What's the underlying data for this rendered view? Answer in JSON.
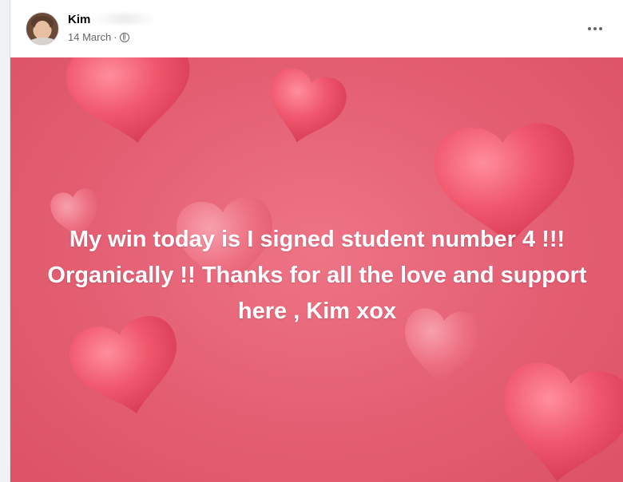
{
  "post": {
    "author_name": "Kim",
    "date": "14 March",
    "separator": "·",
    "privacy_icon": "globe-icon",
    "more_icon": "more-options-icon",
    "message": "My win today is I signed student number 4 !!! Organically !! Thanks for all the love and support here , Kim xox",
    "background_color": "#e45e72",
    "heart_color": "#f26b7e",
    "text_color": "#ffffff"
  }
}
